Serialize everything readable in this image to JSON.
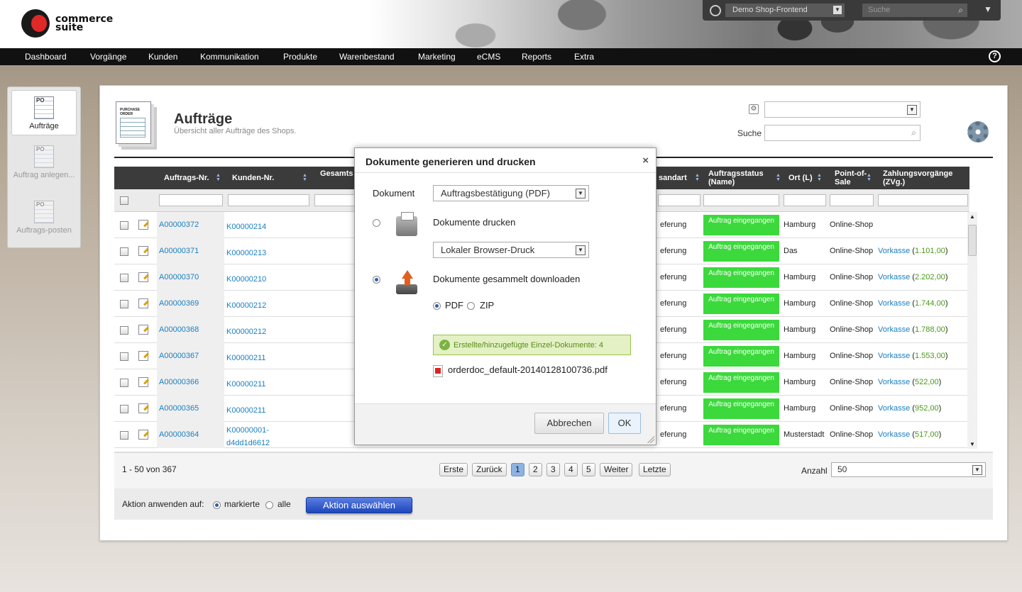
{
  "brand": {
    "name_line1": "commerce",
    "name_line2": "suite"
  },
  "topbar": {
    "shop_select": "Demo Shop-Frontend",
    "search_placeholder": "Suche"
  },
  "nav": [
    "Dashboard",
    "Vorgänge",
    "Kunden",
    "Kommunikation",
    "Produkte",
    "Warenbestand",
    "Marketing",
    "eCMS",
    "Reports",
    "Extra"
  ],
  "help_label": "?",
  "sidebar": [
    {
      "label": "Aufträge",
      "active": true
    },
    {
      "label": "Auftrag anlegen...",
      "active": false
    },
    {
      "label": "Auftrags-posten",
      "active": false
    }
  ],
  "page": {
    "icon_label": "PURCHASE ORDER",
    "title": "Aufträge",
    "subtitle": "Übersicht aller Aufträge des Shops.",
    "search_label": "Suche"
  },
  "table": {
    "headers": [
      "Auftrags-Nr.",
      "Kunden-Nr.",
      "Gesamts",
      "sandart",
      "Auftragsstatus (Name)",
      "Ort (L)",
      "Point-of-Sale",
      "Zahlungsvorgänge (ZVg.)"
    ],
    "rows": [
      {
        "id": "A00000372",
        "customer": "K00000214",
        "ship": "eferung",
        "status": "Auftrag eingegangen",
        "city": "Hamburg",
        "pos": "Online-Shop",
        "pay": "",
        "amount": ""
      },
      {
        "id": "A00000371",
        "customer": "K00000213",
        "ship": "eferung",
        "status": "Auftrag eingegangen",
        "city": "Das",
        "pos": "Online-Shop",
        "pay": "Vorkasse",
        "amount": "1.101,00"
      },
      {
        "id": "A00000370",
        "customer": "K00000210",
        "ship": "eferung",
        "status": "Auftrag eingegangen",
        "city": "Hamburg",
        "pos": "Online-Shop",
        "pay": "Vorkasse",
        "amount": "2.202,00"
      },
      {
        "id": "A00000369",
        "customer": "K00000212",
        "ship": "eferung",
        "status": "Auftrag eingegangen",
        "city": "Hamburg",
        "pos": "Online-Shop",
        "pay": "Vorkasse",
        "amount": "1.744,00"
      },
      {
        "id": "A00000368",
        "customer": "K00000212",
        "ship": "eferung",
        "status": "Auftrag eingegangen",
        "city": "Hamburg",
        "pos": "Online-Shop",
        "pay": "Vorkasse",
        "amount": "1.788,00"
      },
      {
        "id": "A00000367",
        "customer": "K00000211",
        "ship": "eferung",
        "status": "Auftrag eingegangen",
        "city": "Hamburg",
        "pos": "Online-Shop",
        "pay": "Vorkasse",
        "amount": "1.553,00"
      },
      {
        "id": "A00000366",
        "customer": "K00000211",
        "ship": "eferung",
        "status": "Auftrag eingegangen",
        "city": "Hamburg",
        "pos": "Online-Shop",
        "pay": "Vorkasse",
        "amount": "522,00"
      },
      {
        "id": "A00000365",
        "customer": "K00000211",
        "ship": "eferung",
        "status": "Auftrag eingegangen",
        "city": "Hamburg",
        "pos": "Online-Shop",
        "pay": "Vorkasse",
        "amount": "952,00"
      },
      {
        "id": "A00000364",
        "customer": "K00000001-d4dd1d6612",
        "ship": "eferung",
        "status": "Auftrag eingegangen",
        "city": "Musterstadt",
        "pos": "Online-Shop",
        "pay": "Vorkasse",
        "amount": "517,00"
      }
    ]
  },
  "pager": {
    "summary": "1 - 50 von 367",
    "first": "Erste",
    "prev": "Zurück",
    "pages": [
      "1",
      "2",
      "3",
      "4",
      "5"
    ],
    "next": "Weiter",
    "last": "Letzte",
    "count_label": "Anzahl",
    "count_value": "50"
  },
  "action": {
    "label": "Aktion anwenden auf:",
    "opt_marked": "markierte",
    "opt_all": "alle",
    "button": "Aktion auswählen"
  },
  "modal": {
    "title": "Dokumente generieren und drucken",
    "close": "×",
    "doc_label": "Dokument",
    "doc_value": "Auftragsbestätigung (PDF)",
    "print_label": "Dokumente drucken",
    "print_value": "Lokaler Browser-Druck",
    "download_label": "Dokumente gesammelt downloaden",
    "fmt_pdf": "PDF",
    "fmt_zip": "ZIP",
    "success": "Erstellte/hinzugefügte Einzel-Dokumente: 4",
    "file": "orderdoc_default-20140128100736.pdf",
    "cancel": "Abbrechen",
    "ok": "OK"
  }
}
